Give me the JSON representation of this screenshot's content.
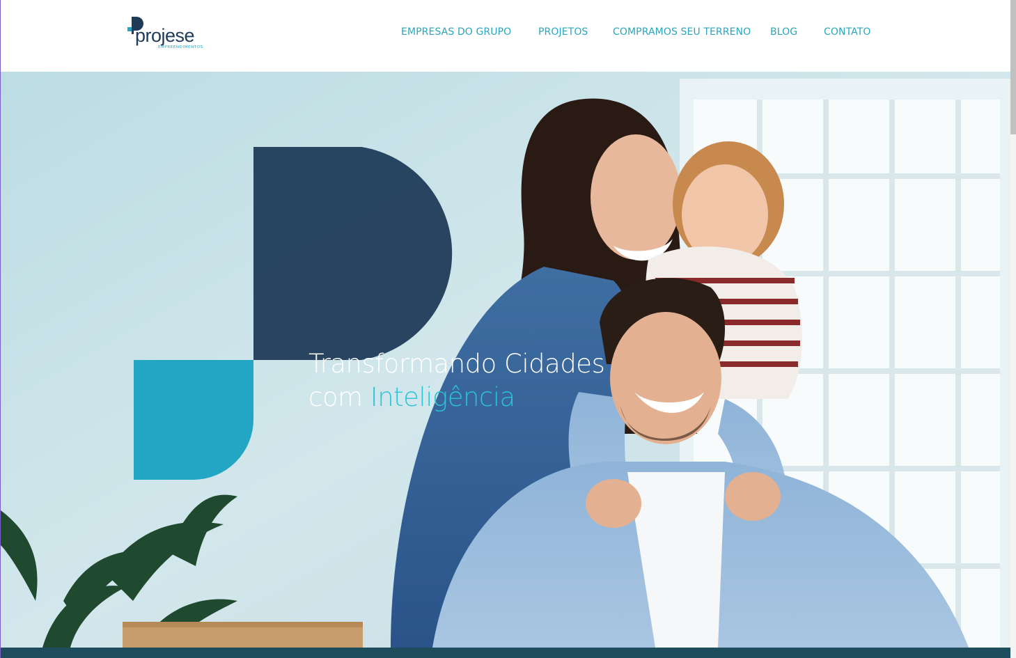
{
  "brand": {
    "name": "projese",
    "tagline": "EMPREENDIMENTOS",
    "primary_color": "#1f3b5a",
    "accent_color": "#22a6c4"
  },
  "nav": {
    "items": [
      {
        "label": "EMPRESAS DO GRUPO"
      },
      {
        "label": "PROJETOS"
      },
      {
        "label": "COMPRAMOS SEU TERRENO"
      },
      {
        "label": "BLOG"
      },
      {
        "label": "CONTATO"
      }
    ]
  },
  "hero": {
    "headline_line1": "Transformando Cidades",
    "headline_line2_prefix": "com ",
    "headline_line2_highlight": "Inteligência",
    "image_description_icon": "family-photo"
  }
}
